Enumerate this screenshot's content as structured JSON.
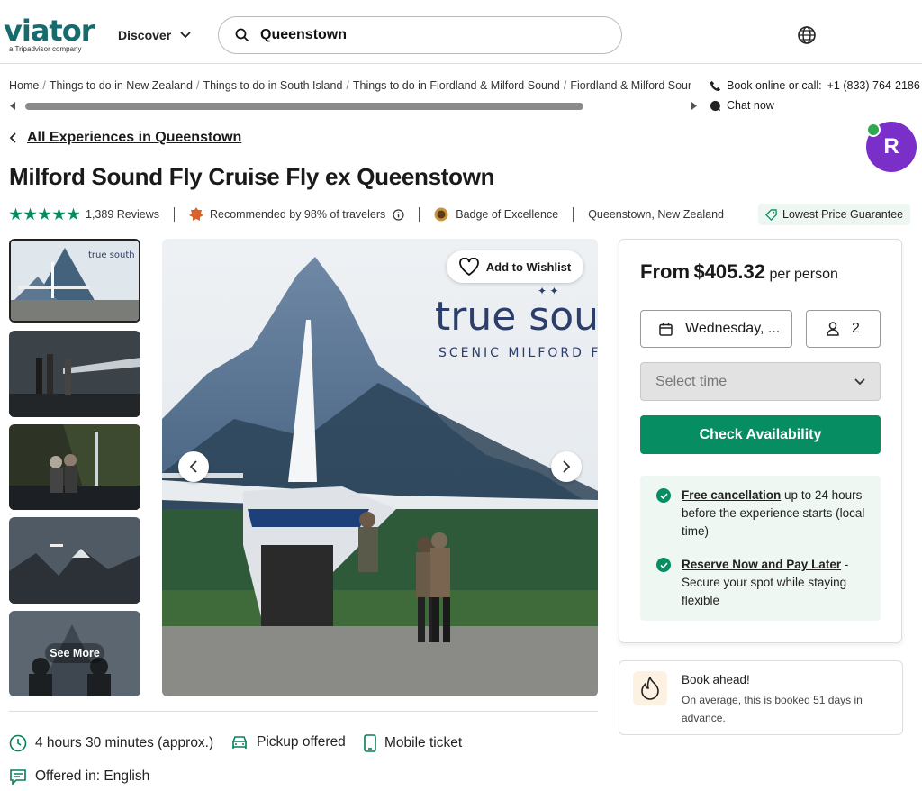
{
  "header": {
    "logo": "viator",
    "logo_sub": "a Tripadvisor company",
    "discover_label": "Discover",
    "search_value": "Queenstown"
  },
  "breadcrumb": [
    "Home",
    "Things to do in New Zealand",
    "Things to do in South Island",
    "Things to do in Fiordland & Milford Sound",
    "Fiordland & Milford Sour"
  ],
  "contact": {
    "book_label": "Book online or call:",
    "phone": "+1 (833) 764-2186",
    "chat_label": "Chat now"
  },
  "user_avatar": "R",
  "back_link": "All Experiences in Queenstown",
  "product": {
    "title": "Milford Sound Fly Cruise Fly ex Queenstown",
    "rating": 5,
    "reviews": "1,389 Reviews",
    "recommended": "Recommended by 98% of travelers",
    "badge": "Badge of Excellence",
    "location": "Queenstown, New Zealand",
    "lowest_price": "Lowest Price Guarantee"
  },
  "gallery": {
    "see_more": "See More",
    "wishlist_label": "Add to Wishlist",
    "brand_name": "true sou",
    "brand_tag": "SCENIC MILFORD FL"
  },
  "booking": {
    "from": "From",
    "price": "$405.32",
    "per": "per person",
    "date": "Wednesday, ...",
    "travelers": "2",
    "time_placeholder": "Select time",
    "check_label": "Check Availability",
    "perk1_title": "Free cancellation",
    "perk1_text": " up to 24 hours before the experience starts (local time)",
    "perk2_title": "Reserve Now and Pay Later",
    "perk2_text": " - Secure your spot while staying flexible"
  },
  "book_ahead": {
    "title": "Book ahead!",
    "text": "On average, this is booked 51 days in advance."
  },
  "features": {
    "duration": "4 hours 30 minutes (approx.)",
    "pickup": "Pickup offered",
    "ticket": "Mobile ticket",
    "language": "Offered in: English"
  },
  "colors": {
    "brand": "#186b6d",
    "primary": "#078d62",
    "avatar": "#7a2fc9"
  }
}
